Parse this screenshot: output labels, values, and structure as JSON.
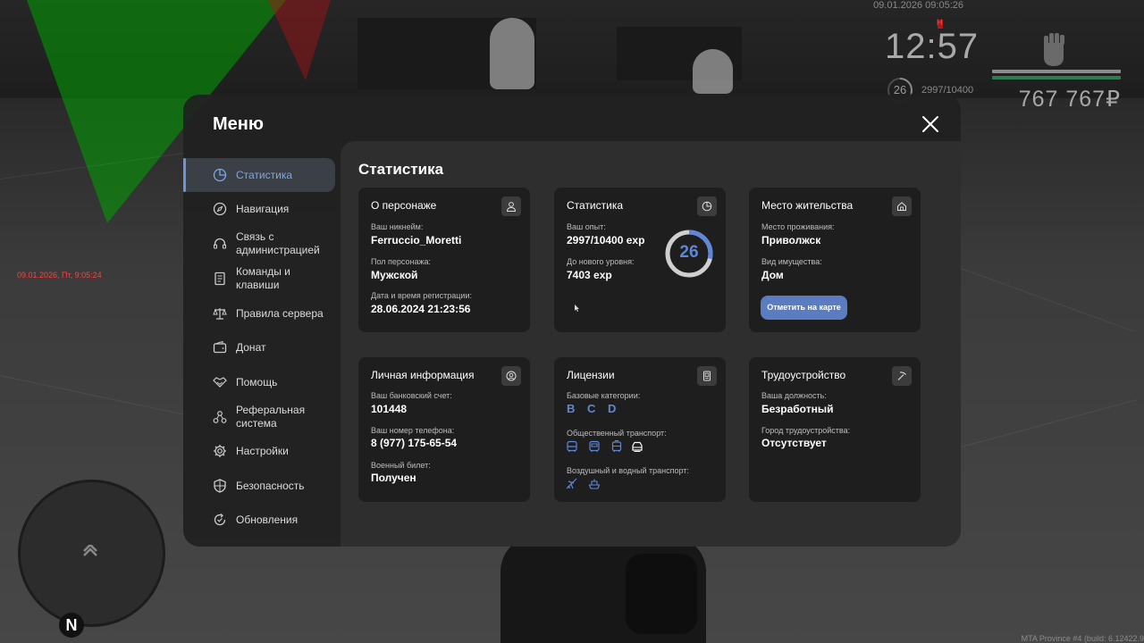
{
  "hud": {
    "datetime": "09.01.2026 09:05:26",
    "marker": "Н",
    "clock": "12:57",
    "level": "26",
    "exp": "2997/10400",
    "money": "767 767₽",
    "red_datetime": "09.01.2026, Пт, 9:05:24",
    "compass": "N",
    "build_info": "MTA Province #4 (build: 6.12422.9",
    "colors": {
      "bar_top": "#8c8c8c",
      "bar_bottom": "#2e7d4e",
      "money": "#a7a7a7"
    }
  },
  "menu": {
    "title": "Меню",
    "close_icon": "close-icon",
    "nav": [
      {
        "label": "Статистика",
        "icon": "pie-chart-icon",
        "active": true
      },
      {
        "label": "Навигация",
        "icon": "compass-icon"
      },
      {
        "label": "Связь с администрацией",
        "icon": "headset-icon"
      },
      {
        "label": "Команды и клавиши",
        "icon": "document-icon"
      },
      {
        "label": "Правила сервера",
        "icon": "scales-icon"
      },
      {
        "label": "Донат",
        "icon": "wallet-icon"
      },
      {
        "label": "Помощь",
        "icon": "handshake-icon"
      },
      {
        "label": "Реферальная система",
        "icon": "referral-icon"
      },
      {
        "label": "Настройки",
        "icon": "gear-icon"
      },
      {
        "label": "Безопасность",
        "icon": "shield-icon"
      },
      {
        "label": "Обновления",
        "icon": "refresh-icon"
      }
    ],
    "accent_color": "#6d94d6"
  },
  "content": {
    "title": "Статистика",
    "character": {
      "title": "О персонаже",
      "icon": "user-icon",
      "fields": [
        {
          "label": "Ваш никнейм:",
          "value": "Ferruccio_Moretti"
        },
        {
          "label": "Пол персонажа:",
          "value": "Мужской"
        },
        {
          "label": "Дата и время регистрации:",
          "value": "28.06.2024 21:23:56"
        }
      ]
    },
    "stats": {
      "title": "Статистика",
      "icon": "pie-chart-icon",
      "fields": [
        {
          "label": "Ваш опыт:",
          "value": "2997/10400 exp"
        },
        {
          "label": "До нового уровня:",
          "value": "7403 exp"
        }
      ],
      "level": "26",
      "progress": 0.288
    },
    "residence": {
      "title": "Место жительства",
      "icon": "home-icon",
      "fields": [
        {
          "label": "Место проживания:",
          "value": "Приволжск"
        },
        {
          "label": "Вид имущества:",
          "value": "Дом"
        }
      ],
      "button": "Отметить на карте"
    },
    "personal": {
      "title": "Личная информация",
      "icon": "user-circle-icon",
      "fields": [
        {
          "label": "Ваш банковский счет:",
          "value": "101448"
        },
        {
          "label": "Ваш номер телефона:",
          "value": "8 (977) 175-65-54"
        },
        {
          "label": "Военный билет:",
          "value": "Получен"
        }
      ]
    },
    "licenses": {
      "title": "Лицензии",
      "icon": "license-icon",
      "base_label": "Базовые категории:",
      "categories": [
        "B",
        "C",
        "D"
      ],
      "public_label": "Общественный транспорт:",
      "public_icons": [
        "bus-icon",
        "bus-icon",
        "tram-icon",
        "taxi-icon"
      ],
      "air_label": "Воздушный и водный транспорт:",
      "air_icons": [
        "plane-icon",
        "boat-icon"
      ]
    },
    "employment": {
      "title": "Трудоустройство",
      "icon": "pickaxe-icon",
      "fields": [
        {
          "label": "Ваша должность:",
          "value": "Безработный"
        },
        {
          "label": "Город трудоустройства:",
          "value": "Отсутствует"
        }
      ]
    }
  }
}
